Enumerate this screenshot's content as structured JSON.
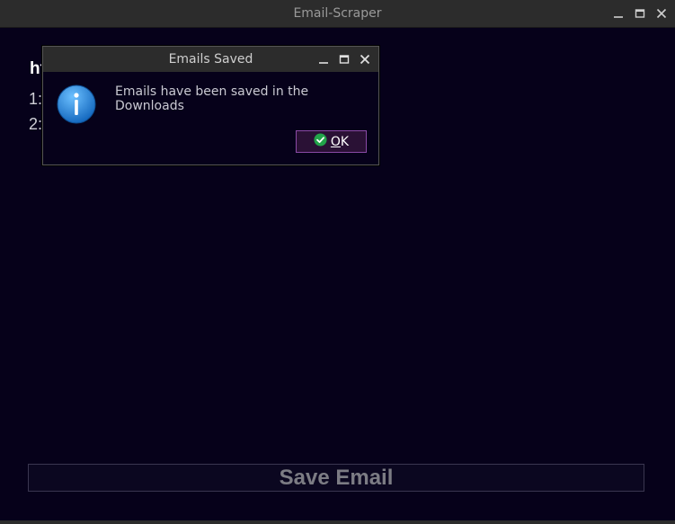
{
  "window": {
    "title": "Email-Scraper"
  },
  "main": {
    "url_heading": "ht",
    "emails": [
      {
        "label": "1:"
      },
      {
        "label": "2:"
      }
    ],
    "save_button_label": "Save Email"
  },
  "dialog": {
    "title": "Emails Saved",
    "message": "Emails have been saved in the Downloads",
    "ok_mnemonic": "O",
    "ok_rest": "K"
  },
  "colors": {
    "background": "#06011a",
    "titlebar": "#2c2c2c",
    "ok_border": "#8a4aa6",
    "info_blue": "#1f7fd0",
    "check_green": "#22a34a"
  },
  "icons": {
    "dialog": "info-icon",
    "ok": "check-icon",
    "minimize": "minimize-icon",
    "maximize": "maximize-icon",
    "close": "close-icon"
  }
}
